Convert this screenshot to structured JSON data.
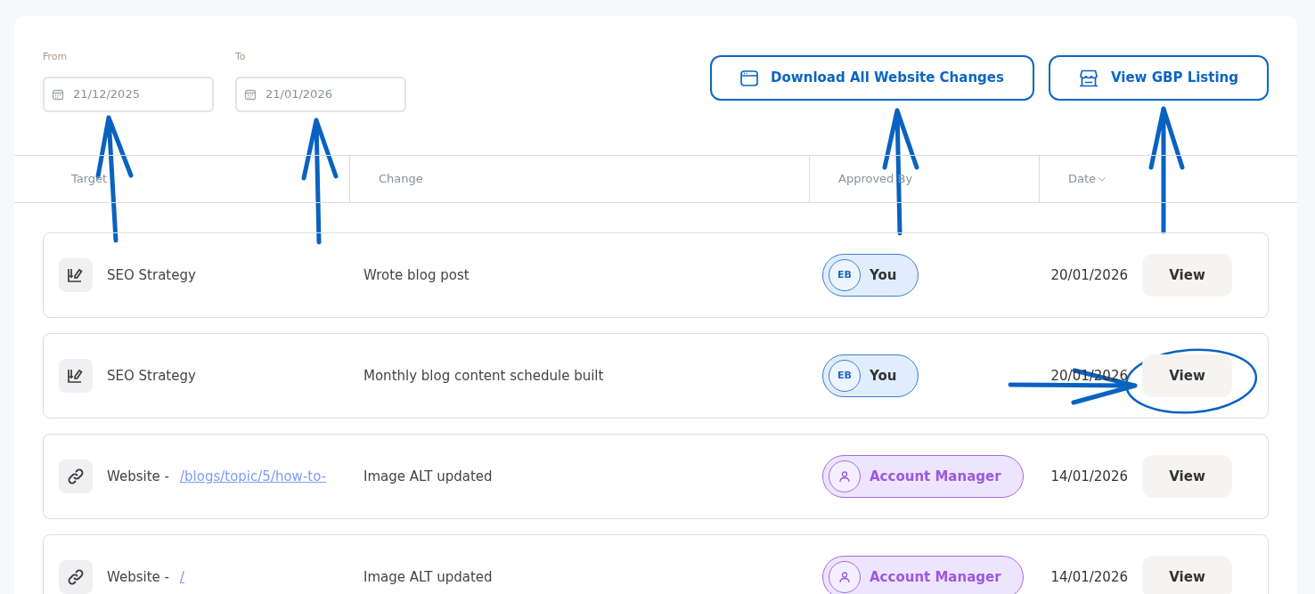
{
  "filters": [
    {
      "label": "From",
      "value": "21/12/2025"
    },
    {
      "label": "To",
      "value": "21/01/2026"
    }
  ],
  "actions": [
    {
      "kind": "download",
      "label": "Download All Website Changes"
    },
    {
      "kind": "listing",
      "label": "View GBP Listing"
    }
  ],
  "table": {
    "columns": [
      {
        "label": "Target",
        "sorted": false
      },
      {
        "label": "Change",
        "sorted": false
      },
      {
        "label": "Approved By",
        "sorted": false
      },
      {
        "label": "Date",
        "sorted": true
      }
    ],
    "rows": [
      {
        "kind": "strategy",
        "target": "SEO Strategy",
        "change": "Wrote blog post",
        "approver": {
          "kind": "user",
          "initials": "EB",
          "name": "You"
        },
        "date": "20/01/2026",
        "action": "View"
      },
      {
        "kind": "strategy",
        "target": "SEO Strategy",
        "change": "Monthly blog content schedule built",
        "approver": {
          "kind": "user",
          "initials": "EB",
          "name": "You"
        },
        "date": "20/01/2026",
        "action": "View"
      },
      {
        "kind": "website",
        "target": "Website - ",
        "link": "/blogs/topic/5/how-to-",
        "change": "Image ALT updated",
        "approver": {
          "kind": "manager",
          "name": "Account Manager"
        },
        "date": "14/01/2026",
        "action": "View"
      },
      {
        "kind": "website",
        "target": "Website - ",
        "link": "/",
        "change": "Image ALT updated",
        "approver": {
          "kind": "manager",
          "name": "Account Manager"
        },
        "date": "14/01/2026",
        "action": "View"
      }
    ]
  }
}
